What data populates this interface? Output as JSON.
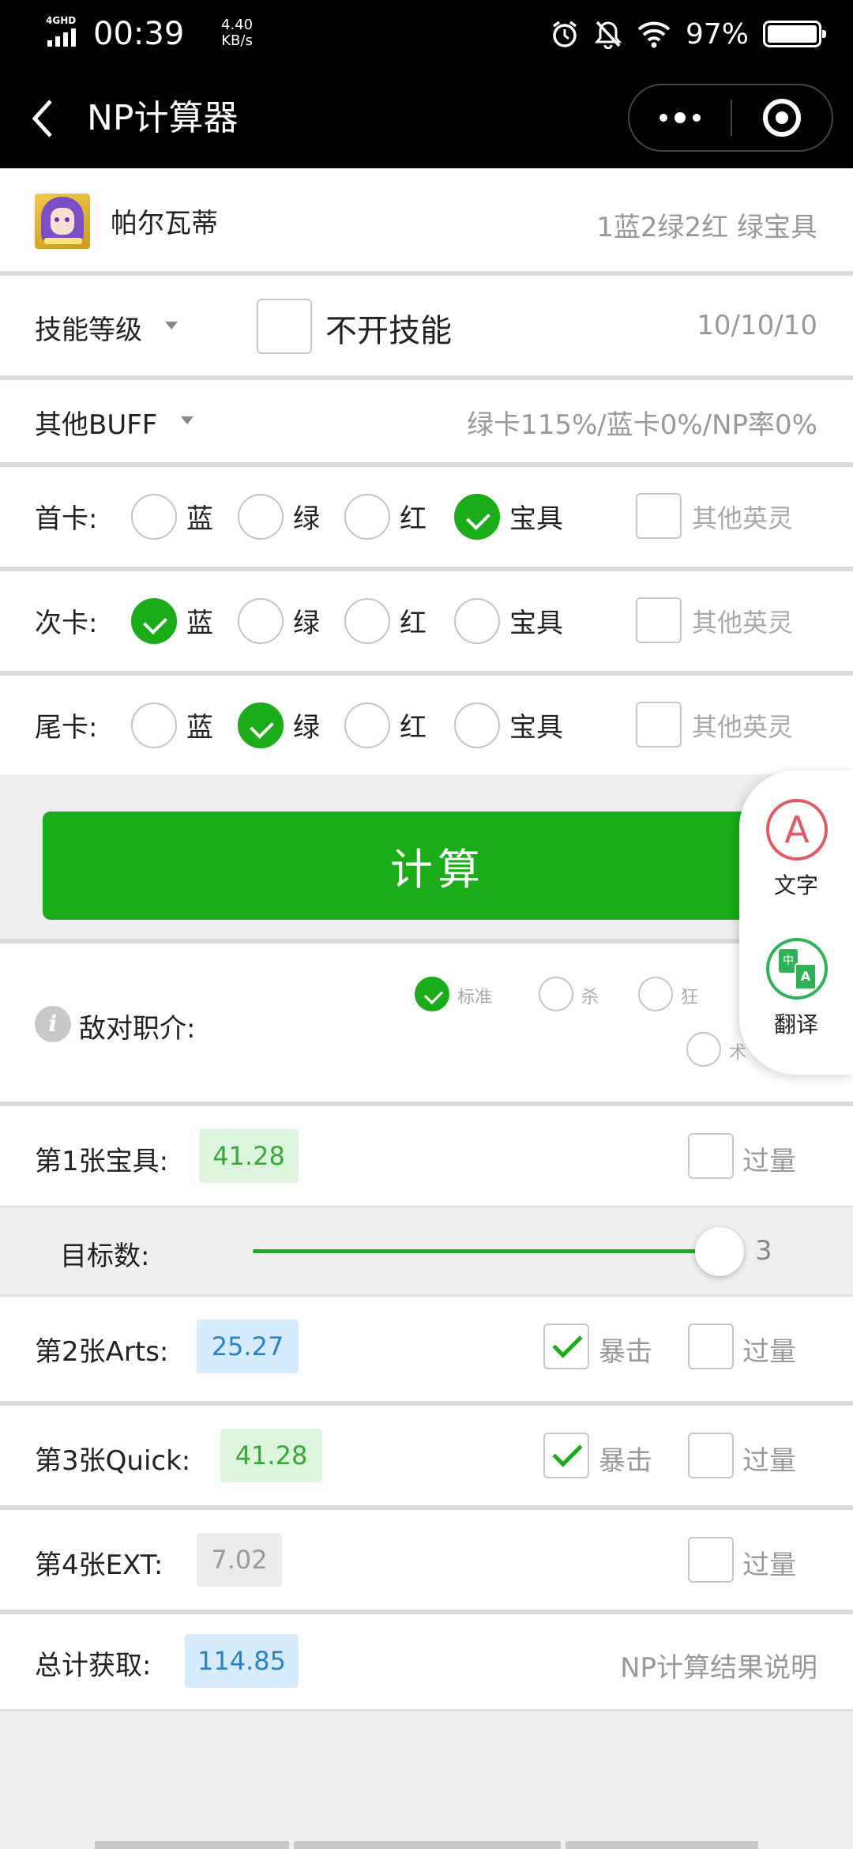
{
  "status": {
    "network": "4GHD",
    "time": "00:39",
    "speed_value": "4.40",
    "speed_unit": "KB/s",
    "battery": "97%"
  },
  "nav": {
    "title": "NP计算器"
  },
  "servant": {
    "name": "帕尔瓦蒂",
    "deck": "1蓝2绿2红 绿宝具"
  },
  "skill": {
    "label": "技能等级",
    "toggle_label": "不开技能",
    "levels": "10/10/10"
  },
  "buff": {
    "label": "其他BUFF",
    "summary": "绿卡115%/蓝卡0%/NP率0%"
  },
  "card_options": [
    "蓝",
    "绿",
    "红",
    "宝具"
  ],
  "other_servant_label": "其他英灵",
  "card_rows": [
    {
      "label": "首卡:",
      "selected": "宝具"
    },
    {
      "label": "次卡:",
      "selected": "蓝"
    },
    {
      "label": "尾卡:",
      "selected": "绿"
    }
  ],
  "calc_button": "计算",
  "enemy": {
    "label": "敌对职介:",
    "options": [
      {
        "label": "标准",
        "selected": true
      },
      {
        "label": "杀",
        "selected": false
      },
      {
        "label": "狂",
        "selected": false
      },
      {
        "label": "术",
        "selected": false
      }
    ]
  },
  "results": [
    {
      "label": "第1张宝具:",
      "value": "41.28",
      "crit": null,
      "overkill_label": "过量"
    },
    {
      "label": "第2张Arts:",
      "value": "25.27",
      "crit": "暴击",
      "overkill_label": "过量"
    },
    {
      "label": "第3张Quick:",
      "value": "41.28",
      "crit": "暴击",
      "overkill_label": "过量"
    },
    {
      "label": "第4张EXT:",
      "value": "7.02",
      "crit": null,
      "overkill_label": "过量"
    }
  ],
  "targets": {
    "label": "目标数:",
    "value": "3",
    "max": 3
  },
  "total": {
    "label": "总计获取:",
    "value": "114.85",
    "link": "NP计算结果说明"
  },
  "float_panel": {
    "text_label": "文字",
    "text_icon": "A",
    "translate_label": "翻译",
    "translate_icon_cn": "中",
    "translate_icon_en": "A"
  },
  "colors": {
    "accent": "#1aad19",
    "nav_bg": "#000000"
  }
}
